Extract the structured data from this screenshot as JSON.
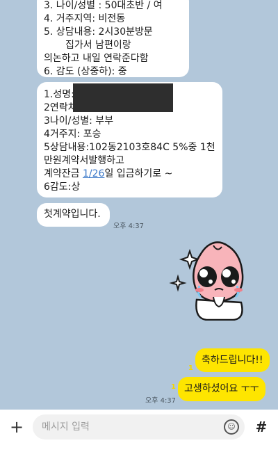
{
  "messages": {
    "first": {
      "lines": [
        "3. 나이/성별 : 50대초반 / 여",
        "4. 거주지역: 비전동",
        "5. 상담내용:  2시30분방문",
        "집가서 남편이랑",
        "의논하고 내일 연락준다함",
        "6. 감도 (상중하): 중"
      ]
    },
    "second": {
      "line1": "1.성명:",
      "line2": "2연락처",
      "line3": "3나이/성별: 부부",
      "line4": "4거주지: 포승",
      "line5": "5상담내용:102동2103호84C 5%중 1천",
      "line6": "만원계약서발행하고",
      "line7_pre": "계약잔금 ",
      "line7_link": "1/26",
      "line7_post": "일 입금하기로 ~",
      "line8": "6감도:상"
    },
    "third": {
      "text": "첫계약입니다.",
      "time": "오후 4:37"
    },
    "mine": [
      {
        "text": "축하드립니다!!",
        "unread": "1"
      },
      {
        "text": "고생하셨어요 ㅜㅜ",
        "unread": "1",
        "time": "오후 4:37"
      }
    ]
  },
  "sticker": {
    "icon": "crying-peach-sticker"
  },
  "input_bar": {
    "placeholder": "메시지 입력",
    "plus_icon": "plus-icon",
    "emoji_icon": "emoji-icon",
    "hash_label": "#"
  },
  "colors": {
    "chat_bg": "#b2c7da",
    "my_bubble": "#fee500",
    "other_bubble": "#ffffff",
    "link": "#3a78c9"
  }
}
